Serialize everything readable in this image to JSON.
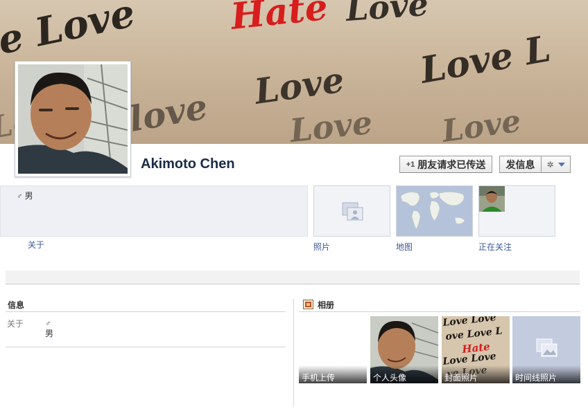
{
  "profile": {
    "name": "Akimoto Chen",
    "gender_symbol": "♂",
    "gender": "男"
  },
  "cover": {
    "words": [
      "Love",
      "Hate"
    ]
  },
  "actions": {
    "friend_request_icon": "+1",
    "friend_request_label": "朋友请求已传送",
    "message_label": "发信息",
    "gear_icon": "✲"
  },
  "intro": {
    "about_link": "关于"
  },
  "apps": [
    {
      "label": "照片",
      "icon": "photo-placeholder-icon"
    },
    {
      "label": "地图",
      "icon": "world-map-icon"
    },
    {
      "label": "正在关注",
      "icon": "friend-avatar"
    }
  ],
  "info_section": {
    "title": "信息",
    "rows": [
      {
        "label": "关于",
        "symbol": "♂",
        "value": "男"
      }
    ]
  },
  "albums_section": {
    "title": "相册",
    "albums": [
      {
        "caption": "手机上传"
      },
      {
        "caption": "个人头像"
      },
      {
        "caption": "封面照片"
      },
      {
        "caption": "时间线照片"
      }
    ]
  },
  "colors": {
    "link": "#3b5998",
    "name": "#1c2a47",
    "tile_bg": "#eef0f5"
  }
}
